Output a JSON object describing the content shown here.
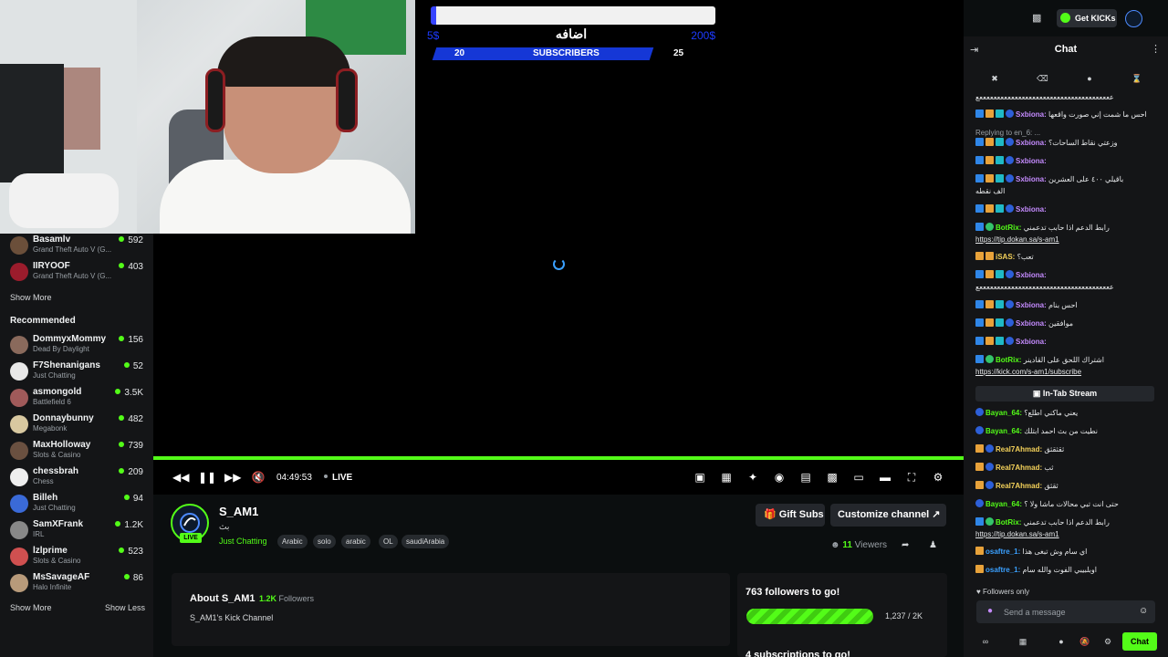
{
  "sidebar": {
    "following_tail": [
      {
        "name": "Basamlv",
        "category": "Grand Theft Auto V (G...",
        "viewers": "592",
        "avatar_color": "#6b4f3a"
      },
      {
        "name": "IIRYOOF",
        "category": "Grand Theft Auto V (G...",
        "viewers": "403",
        "avatar_color": "#9b1c2c"
      }
    ],
    "show_more_1": "Show More",
    "recommended_heading": "Recommended",
    "recommended": [
      {
        "name": "DommyxMommy",
        "category": "Dead By Daylight",
        "viewers": "156",
        "avatar_color": "#8a6a5c"
      },
      {
        "name": "F7Shenanigans",
        "category": "Just Chatting",
        "viewers": "52",
        "avatar_color": "#e8e8e8"
      },
      {
        "name": "asmongold",
        "category": "Battlefield 6",
        "viewers": "3.5K",
        "avatar_color": "#a05a5a"
      },
      {
        "name": "Donnaybunny",
        "category": "Megabonk",
        "viewers": "482",
        "avatar_color": "#d8c8a0"
      },
      {
        "name": "MaxHolloway",
        "category": "Slots & Casino",
        "viewers": "739",
        "avatar_color": "#6a5040"
      },
      {
        "name": "chessbrah",
        "category": "Chess",
        "viewers": "209",
        "avatar_color": "#eeeeee"
      },
      {
        "name": "Billeh",
        "category": "Just Chatting",
        "viewers": "94",
        "avatar_color": "#3a6ad8"
      },
      {
        "name": "SamXFrank",
        "category": "IRL",
        "viewers": "1.2K",
        "avatar_color": "#888888"
      },
      {
        "name": "lzlprime",
        "category": "Slots & Casino",
        "viewers": "523",
        "avatar_color": "#d05050"
      },
      {
        "name": "MsSavageAF",
        "category": "Halo Infinite",
        "viewers": "86",
        "avatar_color": "#b89a7a"
      }
    ],
    "show_more_2": "Show More",
    "show_less": "Show Less"
  },
  "stream_overlay": {
    "goal_title": "اضافه",
    "goal_min": "5$",
    "goal_max": "200$",
    "sub_left": "20",
    "sub_label": "SUBSCRIBERS",
    "sub_right": "25"
  },
  "player": {
    "time": "04:49:53",
    "live_label": "LIVE",
    "progress_fraction": 1.0
  },
  "channel": {
    "name": "S_AM1",
    "subtitle": "بث",
    "live_badge": "LIVE",
    "category": "Just Chatting",
    "tags": [
      "Arabic",
      "solo",
      "arabic",
      "OL",
      "saudiArabia"
    ],
    "gift_subs": "Gift Subs",
    "customize": "Customize channel",
    "viewer_count": "11",
    "viewers_label": "Viewers",
    "about_title": "About S_AM1",
    "followers_count": "1.2K",
    "followers_label": "Followers",
    "about_desc": "S_AM1's Kick Channel",
    "goal_heading": "763 followers to go!",
    "goal_count": "1,237 / 2K",
    "goal_fraction": 0.6185,
    "subs_goal_heading": "4 subscriptions to go!"
  },
  "topbar": {
    "get_kicks": "Get KICKs"
  },
  "chat": {
    "title": "Chat",
    "intab_stream": "In-Tab Stream",
    "followers_only": "Followers only",
    "input_placeholder": "Send a message",
    "send_label": "Chat",
    "user_color_sxbiona": "#c58bff",
    "user_color_botrix": "#53fc18",
    "user_color_bayan": "#53fc18",
    "user_color_real": "#f5d25a",
    "user_color_osaftre": "#3aa0ff",
    "messages": [
      {
        "user": "",
        "text": "ععععععععععععععععععععععععععععععععععععععع"
      },
      {
        "user": "Sxbiona:",
        "text": "احس ما شمت إني صورت واقعها"
      },
      {
        "user": "",
        "text": "Replying to en_6: ...",
        "reply": true
      },
      {
        "user": "Sxbiona:",
        "text": "وزعتي نقاط الساحات؟"
      },
      {
        "user": "Sxbiona:",
        "text": ""
      },
      {
        "user": "Sxbiona:",
        "text": "باقيلي ٤٠٠ على العشرين"
      },
      {
        "user": "",
        "text": "الف نقطه"
      },
      {
        "user": "Sxbiona:",
        "text": ""
      },
      {
        "user": "BotRix:",
        "text": "رابط الدعم اذا حابب تدعمني"
      },
      {
        "user": "",
        "text": "https://tip.dokan.sa/s-am1",
        "link": true
      },
      {
        "user": "iSAS:",
        "text": "تعب؟"
      },
      {
        "user": "Sxbiona:",
        "text": ""
      },
      {
        "user": "",
        "text": "ععععععععععععععععععععععععععععععععععععععع"
      },
      {
        "user": "Sxbiona:",
        "text": "احس بنام"
      },
      {
        "user": "Sxbiona:",
        "text": "موافقين"
      },
      {
        "user": "Sxbiona:",
        "text": ""
      },
      {
        "user": "BotRix:",
        "text": "اشتراك اللحق على القادينر"
      },
      {
        "user": "",
        "text": "https://kick.com/s-am1/subscribe",
        "link": true
      },
      {
        "user": "Bayan_64:",
        "text": "يعني ماكني اطلع؟"
      },
      {
        "user": "Bayan_64:",
        "text": "نطيت من بث احمد ابتلك"
      },
      {
        "user": "Real7Ahmad:",
        "text": "ثقثقثق"
      },
      {
        "user": "Real7Ahmad:",
        "text": "ثب"
      },
      {
        "user": "Real7Ahmad:",
        "text": "ثقثق"
      },
      {
        "user": "Bayan_64:",
        "text": "حتى انت تبي محالات ماشا ولا ؟"
      },
      {
        "user": "BotRix:",
        "text": "رابط الدعم اذا حابب تدعمني"
      },
      {
        "user": "",
        "text": "https://tip.dokan.sa/s-am1",
        "link": true
      },
      {
        "user": "osaftre_1:",
        "text": "اي سام وش تبغى هذا"
      },
      {
        "user": "osaftre_1:",
        "text": "اوبلبيبي الفوت والله سام"
      }
    ]
  }
}
